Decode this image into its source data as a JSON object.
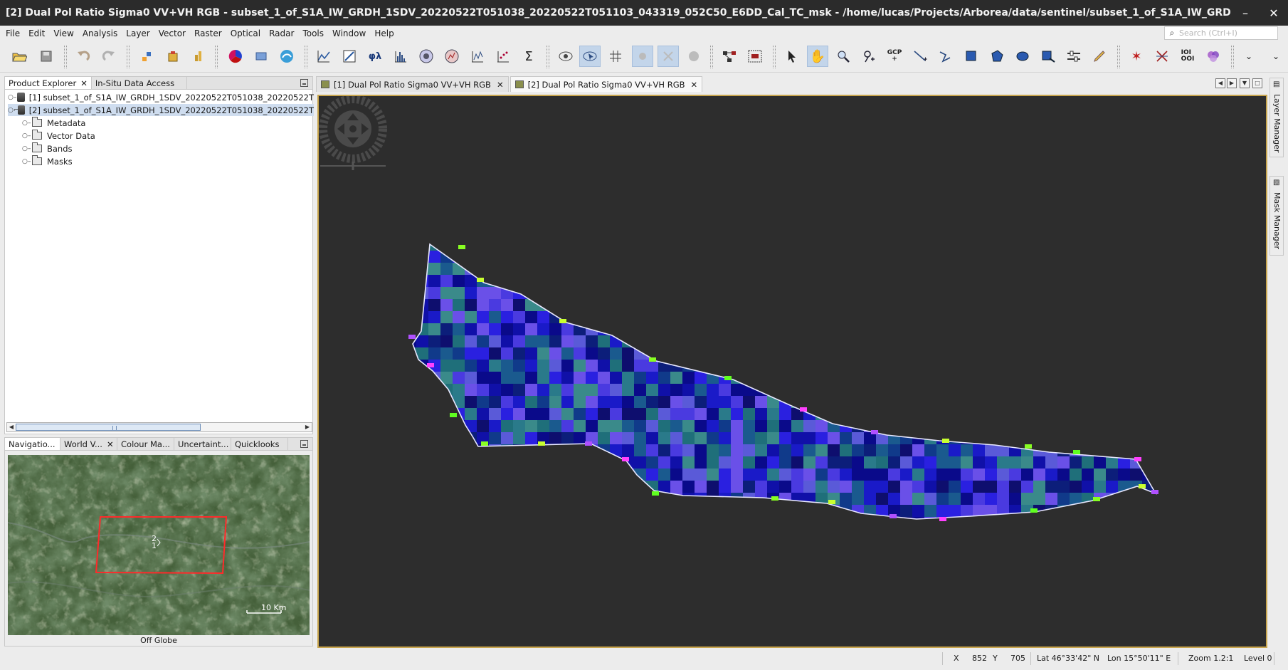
{
  "window": {
    "title": "[2] Dual Pol Ratio Sigma0 VV+VH RGB - subset_1_of_S1A_IW_GRDH_1SDV_20220522T051038_20220522T051103_043319_052C50_E6DD_Cal_TC_msk - /home/lucas/Projects/Arborea/data/sentinel/subset_1_of_S1A_IW_GRDH_1SDV_20220522T...",
    "minimize_label": "–",
    "close_label": "✕"
  },
  "menu": [
    "File",
    "Edit",
    "View",
    "Analysis",
    "Layer",
    "Vector",
    "Raster",
    "Optical",
    "Radar",
    "Tools",
    "Window",
    "Help"
  ],
  "search": {
    "placeholder": "Search (Ctrl+I)"
  },
  "toolbar": {
    "gcp_label": "GCP"
  },
  "product_explorer": {
    "tabs": [
      "Product Explorer",
      "In-Situ Data Access"
    ],
    "products": [
      "[1] subset_1_of_S1A_IW_GRDH_1SDV_20220522T051038_20220522T",
      "[2] subset_1_of_S1A_IW_GRDH_1SDV_20220522T051038_20220522T"
    ],
    "nodes": [
      "Metadata",
      "Vector Data",
      "Bands",
      "Masks"
    ]
  },
  "bottom_panel": {
    "tabs": [
      "Navigatio...",
      "World V...",
      "Colour Ma...",
      "Uncertaint...",
      "Quicklooks"
    ],
    "scale_label": "10 Km",
    "marker_2": "2",
    "marker_1": "1",
    "footer": "Off Globe"
  },
  "views": {
    "tabs": [
      "[1] Dual Pol Ratio Sigma0 VV+VH RGB",
      "[2] Dual Pol Ratio Sigma0 VV+VH RGB"
    ],
    "active_index": 1
  },
  "side_tabs": [
    "Layer Manager",
    "Mask Manager"
  ],
  "status": {
    "x_label": "X",
    "x_value": "852",
    "y_label": "Y",
    "y_value": "705",
    "lat": "Lat 46°33'42\" N",
    "lon": "Lon 15°50'11\" E",
    "zoom": "Zoom 1.2:1",
    "level": "Level 0"
  },
  "colors": {
    "canvas_bg": "#2d2d2d",
    "canvas_border": "#c8a54d",
    "selection": "#cfddef",
    "nav_box": "#ff2a2a"
  }
}
